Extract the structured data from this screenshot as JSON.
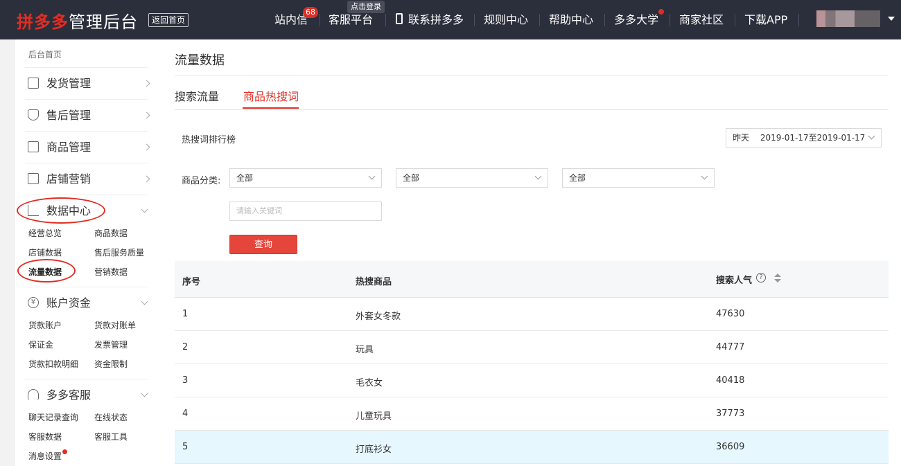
{
  "header": {
    "logo_brand": "拼多多",
    "logo_rest": "管理后台",
    "home_button": "返回首页",
    "nav": {
      "messages": "站内信",
      "messages_badge": "68",
      "service": "客服平台",
      "service_tooltip": "点击登录",
      "contact": "联系拼多多",
      "rules": "规则中心",
      "help": "帮助中心",
      "university": "多多大学",
      "community": "商家社区",
      "download": "下载APP"
    }
  },
  "sidebar": {
    "home": "后台首页",
    "groups": [
      {
        "label": "发货管理",
        "icon": "document-icon"
      },
      {
        "label": "售后管理",
        "icon": "shield-icon"
      },
      {
        "label": "商品管理",
        "icon": "product-icon"
      },
      {
        "label": "店铺营销",
        "icon": "gift-icon"
      }
    ],
    "data_center": {
      "label": "数据中心",
      "icon": "bar-chart-icon",
      "items": [
        "经营总览",
        "商品数据",
        "店铺数据",
        "售后服务质量",
        "流量数据",
        "营销数据"
      ],
      "active": "流量数据"
    },
    "account": {
      "label": "账户资金",
      "icon": "yen-icon",
      "items": [
        "货款账户",
        "货款对账单",
        "保证金",
        "发票管理",
        "货款扣款明细",
        "资金限制"
      ]
    },
    "service": {
      "label": "多多客服",
      "icon": "headset-icon",
      "items": [
        "聊天记录查询",
        "在线状态",
        "客服数据",
        "客服工具",
        "消息设置"
      ]
    }
  },
  "main": {
    "title": "流量数据",
    "tabs": [
      "搜索流量",
      "商品热搜词"
    ],
    "active_tab": "商品热搜词",
    "ranking_label": "热搜词排行榜",
    "date_range": {
      "preset": "昨天",
      "value": "2019-01-17至2019-01-17"
    },
    "category_label": "商品分类:",
    "category_selects": [
      "全部",
      "全部",
      "全部"
    ],
    "keyword_placeholder": "请输入关键词",
    "query_button": "查询",
    "table": {
      "columns": [
        "序号",
        "热搜商品",
        "搜索人气"
      ],
      "rows": [
        {
          "rank": "1",
          "keyword": "外套女冬款",
          "popularity": "47630"
        },
        {
          "rank": "2",
          "keyword": "玩具",
          "popularity": "44777"
        },
        {
          "rank": "3",
          "keyword": "毛衣女",
          "popularity": "40418"
        },
        {
          "rank": "4",
          "keyword": "儿童玩具",
          "popularity": "37773"
        },
        {
          "rank": "5",
          "keyword": "打底衫女",
          "popularity": "36609"
        }
      ]
    }
  },
  "colors": {
    "brand_red": "#e02e24",
    "topbar": "#2b2e3b",
    "highlight_row": "#e6f7fd"
  }
}
